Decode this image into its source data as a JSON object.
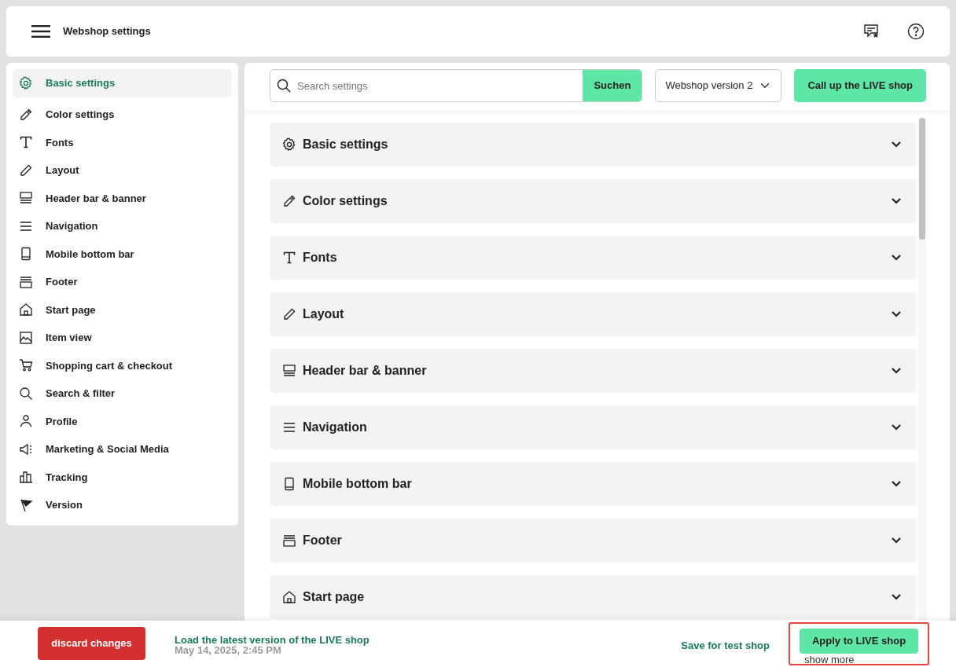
{
  "header": {
    "title": "Webshop settings"
  },
  "sidebar": {
    "items": [
      {
        "label": "Basic settings",
        "selected": true
      },
      {
        "label": "Color settings",
        "selected": false
      },
      {
        "label": "Fonts",
        "selected": false
      },
      {
        "label": "Layout",
        "selected": false
      },
      {
        "label": "Header bar & banner",
        "selected": false
      },
      {
        "label": "Navigation",
        "selected": false
      },
      {
        "label": "Mobile bottom bar",
        "selected": false
      },
      {
        "label": "Footer",
        "selected": false
      },
      {
        "label": "Start page",
        "selected": false
      },
      {
        "label": "Item view",
        "selected": false
      },
      {
        "label": "Shopping cart & checkout",
        "selected": false
      },
      {
        "label": "Search & filter",
        "selected": false
      },
      {
        "label": "Profile",
        "selected": false
      },
      {
        "label": "Marketing & Social Media",
        "selected": false
      },
      {
        "label": "Tracking",
        "selected": false
      },
      {
        "label": "Version",
        "selected": false
      }
    ]
  },
  "toolbar": {
    "search": {
      "placeholder": "Search settings",
      "button": "Suchen"
    },
    "version_select": {
      "value": "Webshop version 2"
    },
    "live_button": "Call up the LIVE shop"
  },
  "sections": [
    {
      "title": "Basic settings",
      "expanded": false
    },
    {
      "title": "Color settings",
      "expanded": false
    },
    {
      "title": "Fonts",
      "expanded": false
    },
    {
      "title": "Layout",
      "expanded": false
    },
    {
      "title": "Header bar & banner",
      "expanded": false
    },
    {
      "title": "Navigation",
      "expanded": false
    },
    {
      "title": "Mobile bottom bar",
      "expanded": false
    },
    {
      "title": "Footer",
      "expanded": false
    },
    {
      "title": "Start page",
      "expanded": false
    }
  ],
  "footer": {
    "discard": "discard changes",
    "load_link": "Load the latest version of the LIVE shop",
    "load_date": "May 14, 2025, 2:45 PM",
    "save_test": "Save for test shop",
    "apply": {
      "label": "Apply to LIVE shop",
      "highlighted": true
    },
    "show_more": "show more"
  }
}
